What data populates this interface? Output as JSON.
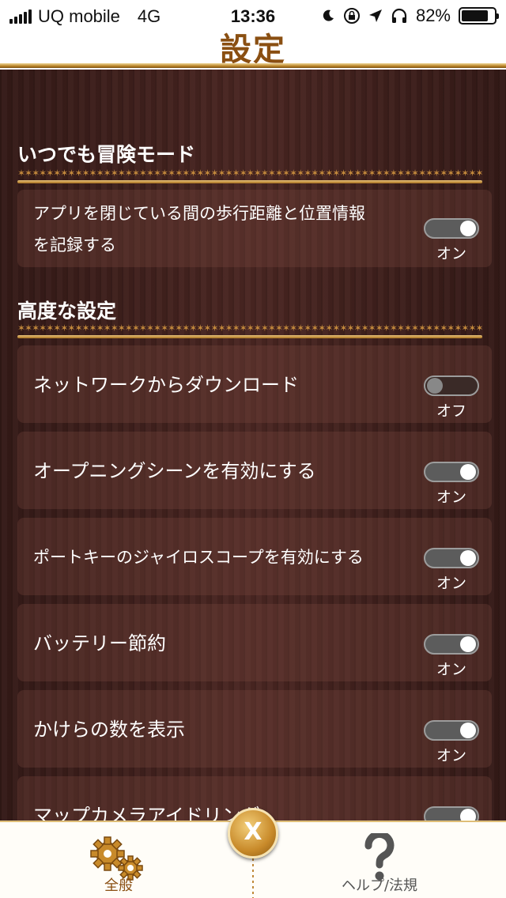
{
  "status": {
    "carrier": "UQ mobile",
    "network": "4G",
    "time": "13:36",
    "battery": "82%",
    "battery_level": 0.82,
    "icons": [
      "signal-icon",
      "moon-icon",
      "orientation-lock-icon",
      "location-icon",
      "headphones-icon",
      "battery-icon"
    ]
  },
  "header": {
    "title": "設定"
  },
  "sections": {
    "adventure": {
      "title": "いつでも冒険モード",
      "item1": {
        "line1": "アプリを閉じている間の歩行距離と位置情報",
        "line2": "を記録する",
        "state": "オン"
      }
    },
    "advanced": {
      "title": "高度な設定",
      "item1": {
        "label": "ネットワークからダウンロード",
        "state": "オフ"
      },
      "item2": {
        "label": "オープニングシーンを有効にする",
        "state": "オン"
      },
      "item3": {
        "label": "ポートキーのジャイロスコープを有効にする",
        "state": "オン"
      },
      "item4": {
        "label": "バッテリー節約",
        "state": "オン"
      },
      "item5": {
        "label": "かけらの数を表示",
        "state": "オン"
      },
      "item6": {
        "label": "マップカメラアイドリング"
      }
    }
  },
  "tabbar": {
    "general_label": "全般",
    "help_label": "ヘルプ/法規",
    "close_label": "X"
  },
  "colors": {
    "accent": "#8a4f12",
    "gold": "#c48a3c",
    "wood": "#3c1f1b"
  }
}
